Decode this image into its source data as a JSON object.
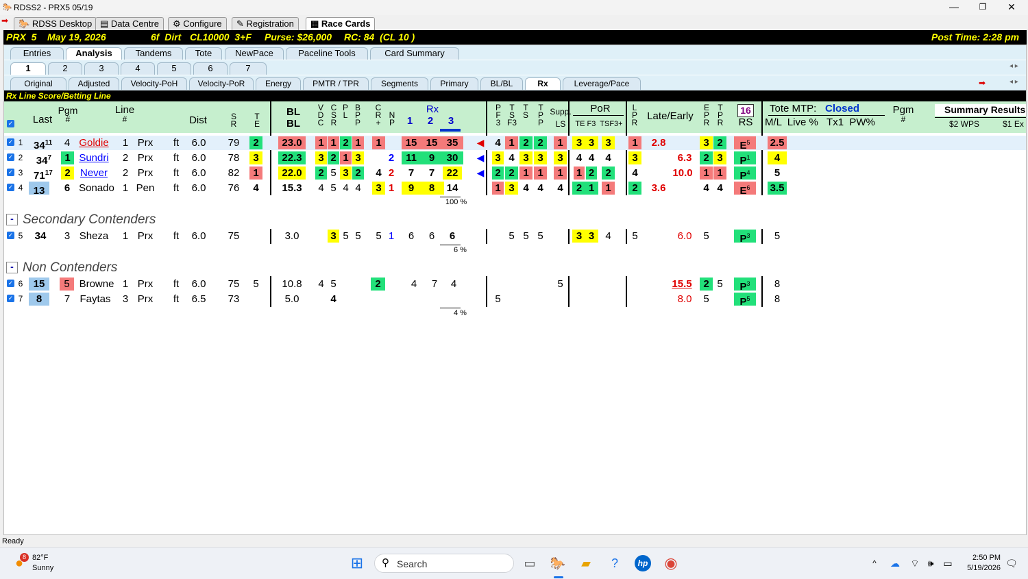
{
  "window": {
    "title": "RDSS2 - PRX5  05/19",
    "min": "—",
    "max": "❐",
    "close": "✕"
  },
  "top_tabs": [
    "RDSS Desktop",
    "Data Centre",
    "Configure",
    "Registration",
    "Race Cards"
  ],
  "race_header": {
    "track": "PRX  5",
    "date": "May 19, 2026",
    "distance": "6f  Dirt",
    "class": "CL10000  3+F",
    "purse": "Purse: $26,000",
    "rc": "RC: 84  (CL 10 )",
    "post_time": "Post Time: 2:28 pm"
  },
  "analysis_tabs": [
    "Entries",
    "Analysis",
    "Tandems",
    "Tote",
    "NewPace",
    "Paceline Tools",
    "Card Summary"
  ],
  "race_tabs": [
    "1",
    "2",
    "3",
    "4",
    "5",
    "6",
    "7"
  ],
  "rx_tabs": [
    "Original",
    "Adjusted",
    "Velocity-PoH",
    "Velocity-PoR",
    "Energy",
    "PMTR / TPR",
    "Segments",
    "Primary",
    "BL/BL",
    "Rx",
    "Leverage/Pace"
  ],
  "section_title": "Rx Line Score/Betting Line",
  "headers": {
    "pgm": "Pgm",
    "last": "Last",
    "hash": "#",
    "line": "Line",
    "dist": "Dist",
    "sr": [
      "S",
      "R"
    ],
    "te": [
      "T",
      "E"
    ],
    "blbl": [
      "BL",
      "BL"
    ],
    "vdc": [
      "V",
      "D",
      "C"
    ],
    "csr": [
      "C",
      "S",
      "R"
    ],
    "pl": [
      "P",
      "L"
    ],
    "bpp": [
      "B",
      "P",
      "P"
    ],
    "cr": [
      "C",
      "R",
      "+"
    ],
    "np": [
      "N",
      "P"
    ],
    "rx": "Rx",
    "rx_cols": [
      "1",
      "2",
      "3"
    ],
    "pf3": [
      "P",
      "F",
      "3"
    ],
    "tsf3": [
      "T",
      "S",
      "F3"
    ],
    "ts": [
      "T",
      "S"
    ],
    "tpp": [
      "T",
      "P",
      "P"
    ],
    "supp": "Supp.",
    "ls": "LS",
    "por": "PoR",
    "por_sub": "TE F3  TSF3+",
    "lpr": [
      "L",
      "P",
      "R"
    ],
    "late_early": "Late/Early",
    "epr": [
      "E",
      "P",
      "R"
    ],
    "tpr": [
      "T",
      "P",
      "R"
    ],
    "rs_badge": "16",
    "rs": "RS",
    "tote_mtp": "Tote MTP:",
    "tote_status": "Closed",
    "tote_sub": "M/L  Live %   Tx1  PW%",
    "pgm2": "Pgm",
    "pgm2_hash": "#",
    "summary": "Summary Results",
    "wps": "$2 WPS",
    "ex": "$1 Ex"
  },
  "contenders": [
    {
      "num": "1",
      "last": "34",
      "last_sup": "11",
      "pgm": "4",
      "name": "Goldie",
      "line": "1",
      "trk": "Prx",
      "sfc": "ft",
      "dist": "6.0",
      "sr": "79",
      "te": "2",
      "bl": "23.0",
      "v": "1",
      "c": "1",
      "p": "2",
      "b": "1",
      "cr": "1",
      "np": "",
      "rx1": "15",
      "rx2": "15",
      "rx3": "35",
      "pf": "4",
      "tsf": "1",
      "ts": "2",
      "tpp": "2",
      "ls": "1",
      "te3": "3",
      "f3": "3",
      "tsf3": "3",
      "lpr": "1",
      "late": "2.8",
      "early": "",
      "epr": "3",
      "tpr": "2",
      "rs": "E",
      "rs_sup": "5",
      "ml": "2.5"
    },
    {
      "num": "2",
      "last": "34",
      "last_sup": "7",
      "pgm": "1",
      "name": "Sundri",
      "line": "2",
      "trk": "Prx",
      "sfc": "ft",
      "dist": "6.0",
      "sr": "78",
      "te": "3",
      "bl": "22.3",
      "v": "3",
      "c": "2",
      "p": "1",
      "b": "3",
      "cr": "",
      "np": "2",
      "rx1": "11",
      "rx2": "9",
      "rx3": "30",
      "pf": "3",
      "tsf": "4",
      "ts": "3",
      "tpp": "3",
      "ls": "3",
      "te3": "4",
      "f3": "4",
      "tsf3": "4",
      "lpr": "3",
      "late": "",
      "early": "6.3",
      "epr": "2",
      "tpr": "3",
      "rs": "P",
      "rs_sup": "1",
      "ml": "4"
    },
    {
      "num": "3",
      "last": "71",
      "last_sup": "17",
      "pgm": "2",
      "name": "Never",
      "line": "2",
      "trk": "Prx",
      "sfc": "ft",
      "dist": "6.0",
      "sr": "82",
      "te": "1",
      "bl": "22.0",
      "v": "2",
      "c": "5",
      "p": "3",
      "b": "2",
      "cr": "4",
      "np": "2",
      "rx1": "7",
      "rx2": "7",
      "rx3": "22",
      "pf": "2",
      "tsf": "2",
      "ts": "1",
      "tpp": "1",
      "ls": "1",
      "te3": "1",
      "f3": "2",
      "tsf3": "2",
      "lpr": "4",
      "late": "",
      "early": "10.0",
      "epr": "1",
      "tpr": "1",
      "rs": "P",
      "rs_sup": "4",
      "ml": "5"
    },
    {
      "num": "4",
      "last": "13",
      "last_sup": "",
      "pgm": "6",
      "name": "Sonado",
      "line": "1",
      "trk": "Pen",
      "sfc": "ft",
      "dist": "6.0",
      "sr": "76",
      "te": "4",
      "bl": "15.3",
      "v": "4",
      "c": "5",
      "p": "4",
      "b": "4",
      "cr": "3",
      "np": "1",
      "rx1": "9",
      "rx2": "8",
      "rx3": "14",
      "pf": "1",
      "tsf": "3",
      "ts": "4",
      "tpp": "4",
      "ls": "4",
      "te3": "2",
      "f3": "1",
      "tsf3": "1",
      "lpr": "2",
      "late": "3.6",
      "early": "",
      "epr": "4",
      "tpr": "4",
      "rs": "E",
      "rs_sup": "6",
      "ml": "3.5"
    }
  ],
  "contenders_pct": "100 %",
  "secondary_title": "Secondary Contenders",
  "secondary": {
    "num": "5",
    "last": "34",
    "pgm": "3",
    "name": "Sheza",
    "line": "1",
    "trk": "Prx",
    "sfc": "ft",
    "dist": "6.0",
    "sr": "75",
    "bl": "3.0",
    "v": "3",
    "c": "5",
    "p": "5",
    "cr": "5",
    "np": "1",
    "rx1": "6",
    "rx2": "6",
    "rx3": "6",
    "pf": "5",
    "tsf": "5",
    "ts": "5",
    "te3": "3",
    "f3": "3",
    "tsf3": "4",
    "lpr": "5",
    "early": "6.0",
    "epr": "5",
    "rs": "P",
    "rs_sup": "3",
    "ml": "5"
  },
  "secondary_pct": "6 %",
  "non_title": "Non Contenders",
  "non": [
    {
      "num": "6",
      "last": "15",
      "pgm": "5",
      "name": "Browne",
      "line": "1",
      "trk": "Prx",
      "sfc": "ft",
      "dist": "6.0",
      "sr": "75",
      "te": "5",
      "bl": "10.8",
      "v": "4",
      "c": "5",
      "cr": "2",
      "rx1": "4",
      "rx2": "7",
      "rx3": "4",
      "ls": "5",
      "early": "15.5",
      "epr": "2",
      "tpr": "5",
      "rs": "P",
      "rs_sup": "3",
      "ml": "8"
    },
    {
      "num": "7",
      "last": "8",
      "pgm": "7",
      "name": "Faytas",
      "line": "3",
      "trk": "Prx",
      "sfc": "ft",
      "dist": "6.5",
      "sr": "73",
      "bl": "5.0",
      "c": "4",
      "pf": "5",
      "early": "8.0",
      "epr": "5",
      "rs": "P",
      "rs_sup": "5",
      "ml": "8"
    }
  ],
  "non_pct": "4 %",
  "status": "Ready",
  "taskbar": {
    "weather_temp": "82°F",
    "weather_desc": "Sunny",
    "weather_badge": "8",
    "search": "Search",
    "time": "2:50 PM",
    "date": "5/19/2026"
  }
}
